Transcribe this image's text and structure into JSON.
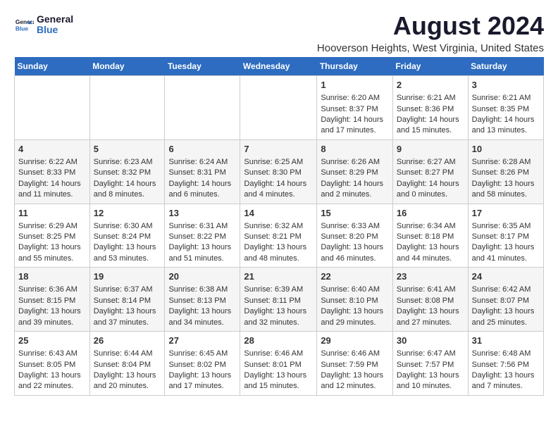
{
  "logo": {
    "line1": "General",
    "line2": "Blue"
  },
  "title": "August 2024",
  "subtitle": "Hooverson Heights, West Virginia, United States",
  "days_of_week": [
    "Sunday",
    "Monday",
    "Tuesday",
    "Wednesday",
    "Thursday",
    "Friday",
    "Saturday"
  ],
  "weeks": [
    [
      {
        "day": "",
        "content": ""
      },
      {
        "day": "",
        "content": ""
      },
      {
        "day": "",
        "content": ""
      },
      {
        "day": "",
        "content": ""
      },
      {
        "day": "1",
        "content": "Sunrise: 6:20 AM\nSunset: 8:37 PM\nDaylight: 14 hours\nand 17 minutes."
      },
      {
        "day": "2",
        "content": "Sunrise: 6:21 AM\nSunset: 8:36 PM\nDaylight: 14 hours\nand 15 minutes."
      },
      {
        "day": "3",
        "content": "Sunrise: 6:21 AM\nSunset: 8:35 PM\nDaylight: 14 hours\nand 13 minutes."
      }
    ],
    [
      {
        "day": "4",
        "content": "Sunrise: 6:22 AM\nSunset: 8:33 PM\nDaylight: 14 hours\nand 11 minutes."
      },
      {
        "day": "5",
        "content": "Sunrise: 6:23 AM\nSunset: 8:32 PM\nDaylight: 14 hours\nand 8 minutes."
      },
      {
        "day": "6",
        "content": "Sunrise: 6:24 AM\nSunset: 8:31 PM\nDaylight: 14 hours\nand 6 minutes."
      },
      {
        "day": "7",
        "content": "Sunrise: 6:25 AM\nSunset: 8:30 PM\nDaylight: 14 hours\nand 4 minutes."
      },
      {
        "day": "8",
        "content": "Sunrise: 6:26 AM\nSunset: 8:29 PM\nDaylight: 14 hours\nand 2 minutes."
      },
      {
        "day": "9",
        "content": "Sunrise: 6:27 AM\nSunset: 8:27 PM\nDaylight: 14 hours\nand 0 minutes."
      },
      {
        "day": "10",
        "content": "Sunrise: 6:28 AM\nSunset: 8:26 PM\nDaylight: 13 hours\nand 58 minutes."
      }
    ],
    [
      {
        "day": "11",
        "content": "Sunrise: 6:29 AM\nSunset: 8:25 PM\nDaylight: 13 hours\nand 55 minutes."
      },
      {
        "day": "12",
        "content": "Sunrise: 6:30 AM\nSunset: 8:24 PM\nDaylight: 13 hours\nand 53 minutes."
      },
      {
        "day": "13",
        "content": "Sunrise: 6:31 AM\nSunset: 8:22 PM\nDaylight: 13 hours\nand 51 minutes."
      },
      {
        "day": "14",
        "content": "Sunrise: 6:32 AM\nSunset: 8:21 PM\nDaylight: 13 hours\nand 48 minutes."
      },
      {
        "day": "15",
        "content": "Sunrise: 6:33 AM\nSunset: 8:20 PM\nDaylight: 13 hours\nand 46 minutes."
      },
      {
        "day": "16",
        "content": "Sunrise: 6:34 AM\nSunset: 8:18 PM\nDaylight: 13 hours\nand 44 minutes."
      },
      {
        "day": "17",
        "content": "Sunrise: 6:35 AM\nSunset: 8:17 PM\nDaylight: 13 hours\nand 41 minutes."
      }
    ],
    [
      {
        "day": "18",
        "content": "Sunrise: 6:36 AM\nSunset: 8:15 PM\nDaylight: 13 hours\nand 39 minutes."
      },
      {
        "day": "19",
        "content": "Sunrise: 6:37 AM\nSunset: 8:14 PM\nDaylight: 13 hours\nand 37 minutes."
      },
      {
        "day": "20",
        "content": "Sunrise: 6:38 AM\nSunset: 8:13 PM\nDaylight: 13 hours\nand 34 minutes."
      },
      {
        "day": "21",
        "content": "Sunrise: 6:39 AM\nSunset: 8:11 PM\nDaylight: 13 hours\nand 32 minutes."
      },
      {
        "day": "22",
        "content": "Sunrise: 6:40 AM\nSunset: 8:10 PM\nDaylight: 13 hours\nand 29 minutes."
      },
      {
        "day": "23",
        "content": "Sunrise: 6:41 AM\nSunset: 8:08 PM\nDaylight: 13 hours\nand 27 minutes."
      },
      {
        "day": "24",
        "content": "Sunrise: 6:42 AM\nSunset: 8:07 PM\nDaylight: 13 hours\nand 25 minutes."
      }
    ],
    [
      {
        "day": "25",
        "content": "Sunrise: 6:43 AM\nSunset: 8:05 PM\nDaylight: 13 hours\nand 22 minutes."
      },
      {
        "day": "26",
        "content": "Sunrise: 6:44 AM\nSunset: 8:04 PM\nDaylight: 13 hours\nand 20 minutes."
      },
      {
        "day": "27",
        "content": "Sunrise: 6:45 AM\nSunset: 8:02 PM\nDaylight: 13 hours\nand 17 minutes."
      },
      {
        "day": "28",
        "content": "Sunrise: 6:46 AM\nSunset: 8:01 PM\nDaylight: 13 hours\nand 15 minutes."
      },
      {
        "day": "29",
        "content": "Sunrise: 6:46 AM\nSunset: 7:59 PM\nDaylight: 13 hours\nand 12 minutes."
      },
      {
        "day": "30",
        "content": "Sunrise: 6:47 AM\nSunset: 7:57 PM\nDaylight: 13 hours\nand 10 minutes."
      },
      {
        "day": "31",
        "content": "Sunrise: 6:48 AM\nSunset: 7:56 PM\nDaylight: 13 hours\nand 7 minutes."
      }
    ]
  ]
}
